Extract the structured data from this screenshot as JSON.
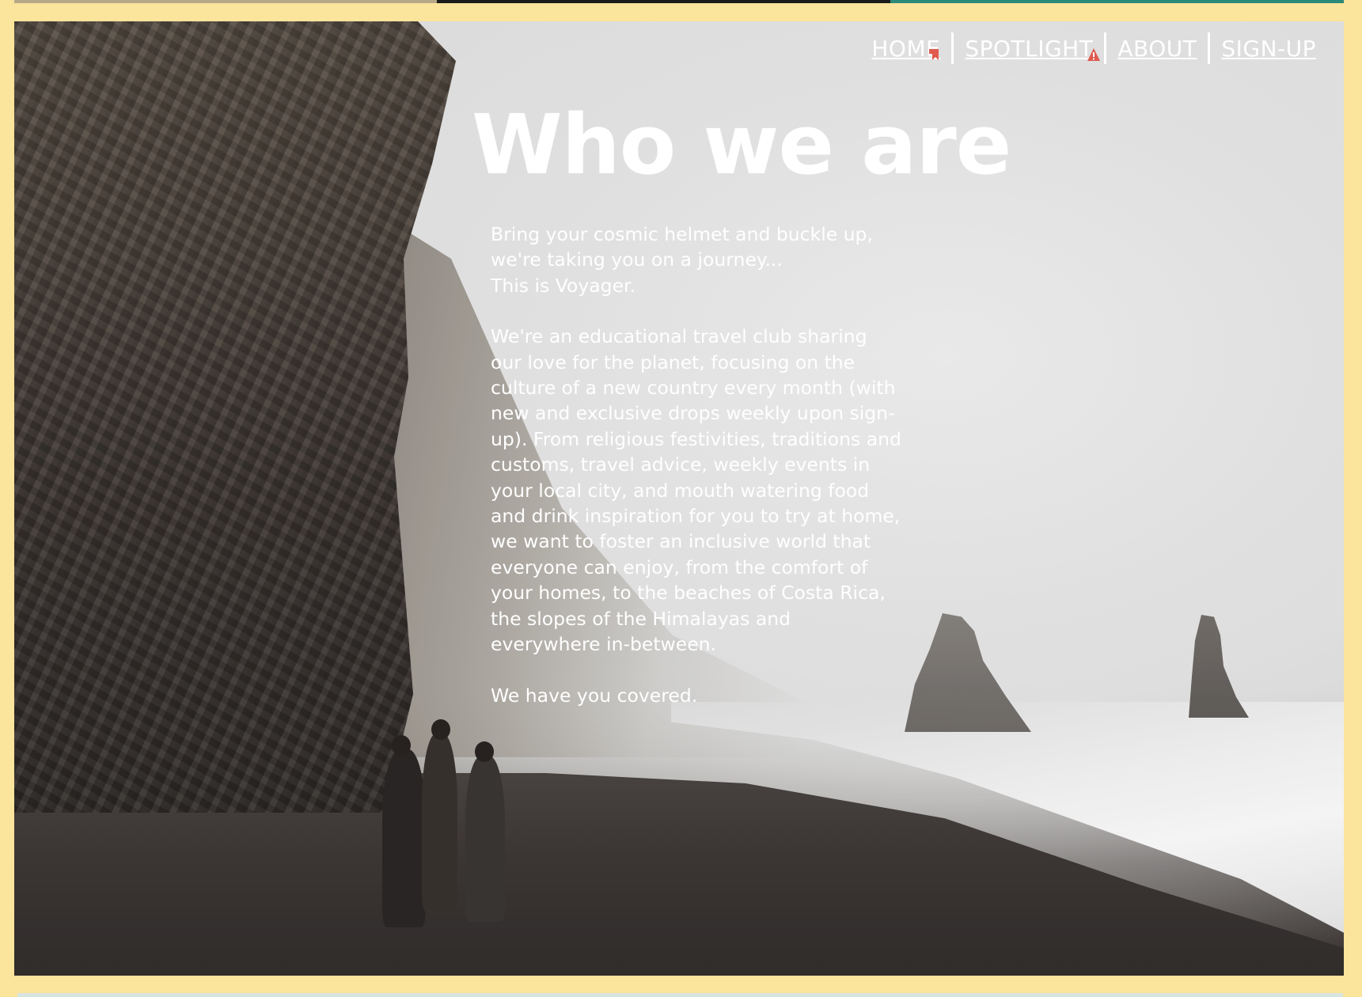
{
  "nav": {
    "items": [
      {
        "label": "HOME",
        "icon": "bookmark-flag-icon"
      },
      {
        "label": "SPOTLIGHT",
        "icon": "warning-icon"
      },
      {
        "label": "ABOUT"
      },
      {
        "label": "SIGN-UP"
      }
    ]
  },
  "hero": {
    "title": "Who we are",
    "intro_lines": [
      "Bring your cosmic helmet and buckle up,",
      "we're taking you on a journey...",
      "This is Voyager."
    ],
    "paragraph": "We're an educational travel club sharing our love for the planet, focusing on the culture of a new country every month (with new and exclusive drops weekly upon sign-up). From religious festivities, traditions and customs, travel advice, weekly events in your local city, and mouth watering food and drink inspiration for you to try at home, we want to foster an inclusive world that everyone can enjoy, from the comfort of your homes, to the beaches of Costa Rica, the slopes of the Himalayas and everywhere in-between.",
    "closing": "We have you covered."
  },
  "colors": {
    "page_background": "#fbe49b",
    "text": "#ffffff",
    "alert_icon": "#e05a4e"
  }
}
